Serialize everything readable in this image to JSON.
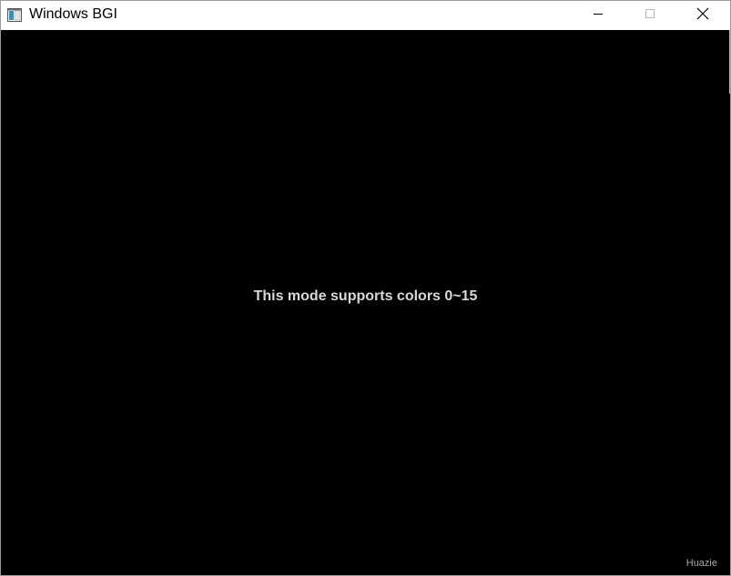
{
  "window": {
    "title": "Windows BGI",
    "app_icon": "window-app-icon",
    "controls": {
      "minimize_icon": "minimize-icon",
      "maximize_icon": "maximize-icon",
      "close_icon": "close-icon"
    }
  },
  "canvas": {
    "background_color": "#000000",
    "message": "This mode supports colors 0~15",
    "message_color": "#d8d8d8",
    "signature": "Huazie"
  }
}
